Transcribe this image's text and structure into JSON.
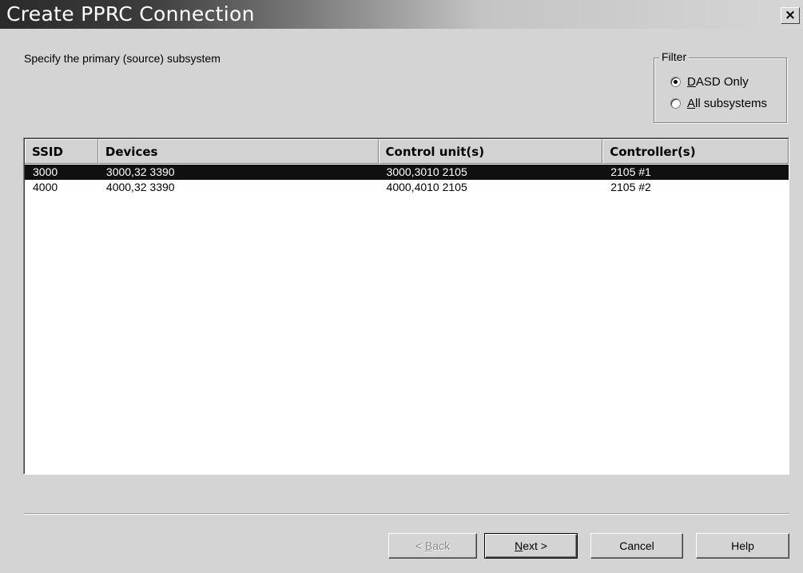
{
  "window": {
    "title": "Create PPRC Connection",
    "close_label": "×"
  },
  "instruction": "Specify the primary (source) subsystem",
  "filter": {
    "label": "Filter",
    "options": [
      {
        "mnemonic": "D",
        "rest": "ASD Only",
        "checked": true
      },
      {
        "mnemonic": "A",
        "rest": "ll subsystems",
        "checked": false
      }
    ]
  },
  "table": {
    "columns": [
      "SSID",
      "Devices",
      "Control unit(s)",
      "Controller(s)"
    ],
    "rows": [
      {
        "ssid": "3000",
        "devices": "3000,32 3390",
        "control_units": "3000,3010 2105",
        "controllers": "2105 #1",
        "selected": true
      },
      {
        "ssid": "4000",
        "devices": "4000,32 3390",
        "control_units": "4000,4010 2105",
        "controllers": "2105 #2",
        "selected": false
      }
    ]
  },
  "buttons": {
    "back": {
      "prefix": "< ",
      "mnemonic": "B",
      "rest": "ack"
    },
    "next": {
      "mnemonic": "N",
      "rest": "ext >"
    },
    "cancel": "Cancel",
    "help": "Help"
  }
}
